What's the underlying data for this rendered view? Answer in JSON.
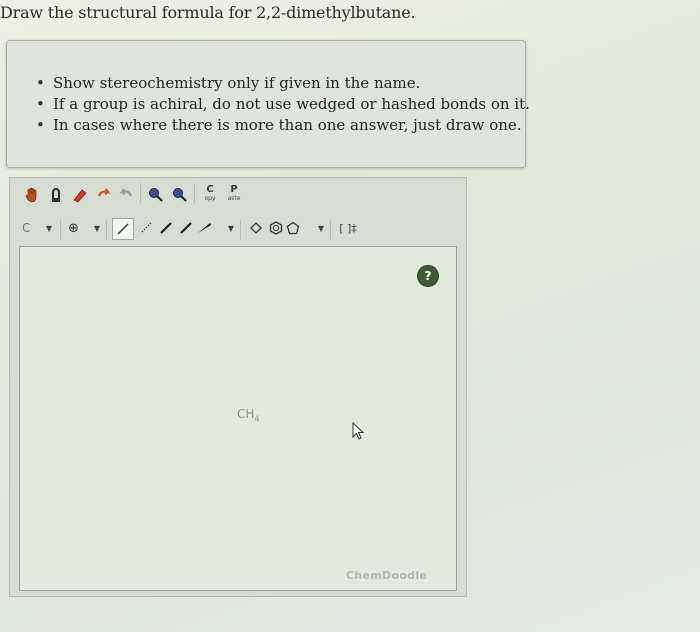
{
  "question": {
    "text": "Draw the structural formula for 2,2-dimethylbutane."
  },
  "instructions": [
    "Show stereochemistry only if given in the name.",
    "If a group is achiral, do not use wedged or hashed bonds on it.",
    "In cases where there is more than one answer, just draw one."
  ],
  "toolbar1": {
    "icons": [
      "hand-icon",
      "lasso-icon",
      "eraser-icon",
      "undo-icon",
      "redo-icon",
      "zoom-in-icon",
      "zoom-out-icon",
      "copy-icon",
      "paste-icon"
    ],
    "copy_label_main": "C",
    "copy_label_sub": "opy",
    "paste_label_main": "P",
    "paste_label_sub": "aste"
  },
  "toolbar2": {
    "atom_label": "C",
    "charge_label": "⊕",
    "template_label": "[ ]‡"
  },
  "canvas": {
    "placeholder_formula": "CH",
    "placeholder_subscript": "4",
    "help_label": "?",
    "watermark": "ChemDoodle"
  }
}
